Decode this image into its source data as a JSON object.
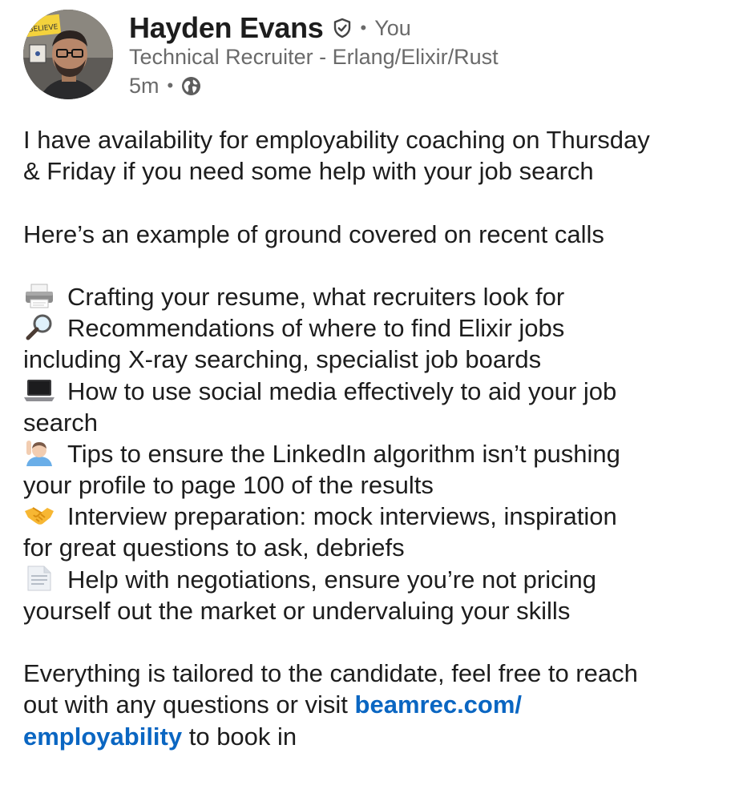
{
  "author": {
    "name": "Hayden Evans",
    "verified_icon": "verified-shield-icon",
    "separator": "•",
    "relation": "You",
    "headline": "Technical Recruiter - Erlang/Elixir/Rust",
    "time": "5m",
    "visibility_icon": "globe-icon",
    "avatar_sign_text": "BELIEVE"
  },
  "post": {
    "intro_line1": "I have availability for employability coaching on Thursday",
    "intro_line2": "& Friday if you need some help with your job search",
    "example_line": "Here’s an example of ground covered on recent calls",
    "items": [
      {
        "icon": "printer-emoji-icon",
        "lines": [
          "Crafting your resume, what recruiters look for"
        ]
      },
      {
        "icon": "magnifying-glass-emoji-icon",
        "lines": [
          "Recommendations of where to find Elixir jobs",
          "including X-ray searching, specialist job boards"
        ]
      },
      {
        "icon": "laptop-emoji-icon",
        "lines": [
          "How to use social media effectively to aid your job",
          "search"
        ]
      },
      {
        "icon": "person-raising-hand-emoji-icon",
        "lines": [
          "Tips to ensure the LinkedIn algorithm isn’t pushing",
          "your profile to page 100 of the results"
        ]
      },
      {
        "icon": "handshake-emoji-icon",
        "lines": [
          "Interview preparation: mock interviews, inspiration",
          "for great questions to ask, debriefs"
        ]
      },
      {
        "icon": "document-emoji-icon",
        "lines": [
          "Help with negotiations, ensure you’re not pricing",
          "yourself out the market or undervaluing your skills"
        ]
      }
    ],
    "closing_line1": "Everything is tailored to the candidate, feel free to reach",
    "closing_line2_prefix": "out with any questions or visit ",
    "link_part1": "beamrec.com/",
    "link_part2": "employability",
    "closing_suffix": " to book in"
  },
  "colors": {
    "link": "#0a66c2",
    "text": "#1d1d1d",
    "meta": "#6a6a6a"
  }
}
